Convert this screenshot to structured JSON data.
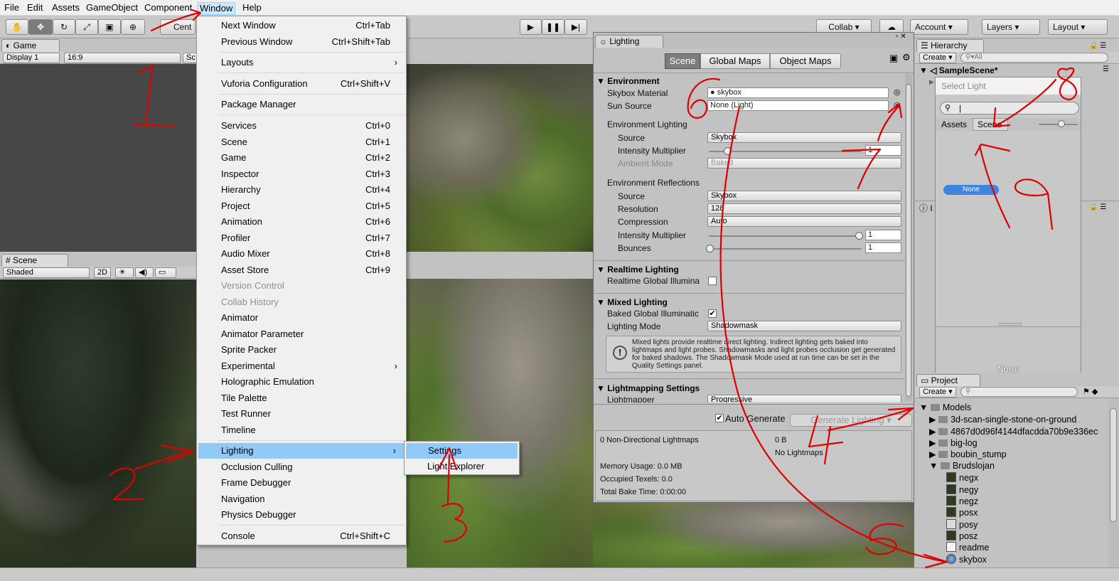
{
  "menubar": {
    "items": [
      "File",
      "Edit",
      "Assets",
      "GameObject",
      "Component",
      "Window",
      "Help"
    ],
    "active": "Window"
  },
  "toolbar": {
    "pivot_label": "Cent",
    "collab": "Collab ▾",
    "account": "Account",
    "layers": "Layers",
    "layout": "Layout"
  },
  "game_panel": {
    "tab": "Game",
    "display": "Display 1",
    "aspect": "16:9",
    "scale": "Sc"
  },
  "scene_panel": {
    "tab": "Scene",
    "shading": "Shaded",
    "mode_2d": "2D"
  },
  "window_menu": {
    "items": [
      {
        "label": "Next Window",
        "shortcut": "Ctrl+Tab"
      },
      {
        "label": "Previous Window",
        "shortcut": "Ctrl+Shift+Tab"
      },
      {
        "label": "Layouts",
        "shortcut": "›"
      },
      {
        "label": "Vuforia Configuration",
        "shortcut": "Ctrl+Shift+V"
      },
      {
        "label": "Package Manager",
        "shortcut": ""
      },
      {
        "label": "Services",
        "shortcut": "Ctrl+0"
      },
      {
        "label": "Scene",
        "shortcut": "Ctrl+1"
      },
      {
        "label": "Game",
        "shortcut": "Ctrl+2"
      },
      {
        "label": "Inspector",
        "shortcut": "Ctrl+3"
      },
      {
        "label": "Hierarchy",
        "shortcut": "Ctrl+4"
      },
      {
        "label": "Project",
        "shortcut": "Ctrl+5"
      },
      {
        "label": "Animation",
        "shortcut": "Ctrl+6"
      },
      {
        "label": "Profiler",
        "shortcut": "Ctrl+7"
      },
      {
        "label": "Audio Mixer",
        "shortcut": "Ctrl+8"
      },
      {
        "label": "Asset Store",
        "shortcut": "Ctrl+9"
      },
      {
        "label": "Version Control",
        "shortcut": ""
      },
      {
        "label": "Collab History",
        "shortcut": ""
      },
      {
        "label": "Animator",
        "shortcut": ""
      },
      {
        "label": "Animator Parameter",
        "shortcut": ""
      },
      {
        "label": "Sprite Packer",
        "shortcut": ""
      },
      {
        "label": "Experimental",
        "shortcut": "›"
      },
      {
        "label": "Holographic Emulation",
        "shortcut": ""
      },
      {
        "label": "Tile Palette",
        "shortcut": ""
      },
      {
        "label": "Test Runner",
        "shortcut": ""
      },
      {
        "label": "Timeline",
        "shortcut": ""
      },
      {
        "label": "Lighting",
        "shortcut": "›"
      },
      {
        "label": "Occlusion Culling",
        "shortcut": ""
      },
      {
        "label": "Frame Debugger",
        "shortcut": ""
      },
      {
        "label": "Navigation",
        "shortcut": ""
      },
      {
        "label": "Physics Debugger",
        "shortcut": ""
      },
      {
        "label": "Console",
        "shortcut": "Ctrl+Shift+C"
      }
    ],
    "submenu": [
      "Settings",
      "Light Explorer"
    ]
  },
  "lighting": {
    "title": "Lighting",
    "tabs": [
      "Scene",
      "Global Maps",
      "Object Maps"
    ],
    "environment": {
      "header": "Environment",
      "skybox_label": "Skybox Material",
      "skybox_value": "skybox",
      "sun_label": "Sun Source",
      "sun_value": "None (Light)",
      "env_lighting": "Environment Lighting",
      "source_label": "Source",
      "source_value": "Skybox",
      "intensity_label": "Intensity Multiplier",
      "intensity_value": "1",
      "ambient_label": "Ambient Mode",
      "ambient_value": "Baked",
      "env_reflections": "Environment Reflections",
      "refl_source_value": "Skybox",
      "resolution_label": "Resolution",
      "resolution_value": "128",
      "compression_label": "Compression",
      "compression_value": "Auto",
      "refl_intensity_value": "1",
      "bounces_label": "Bounces",
      "bounces_value": "1"
    },
    "realtime": {
      "header": "Realtime Lighting",
      "gi_label": "Realtime Global Illumina"
    },
    "mixed": {
      "header": "Mixed Lighting",
      "baked_label": "Baked Global Illuminatic",
      "mode_label": "Lighting Mode",
      "mode_value": "Shadowmask",
      "info": "Mixed lights provide realtime direct lighting. Indirect lighting gets baked into lightmaps and light probes. Shadowmasks and light probes occlusion get generated for baked shadows. The Shadowmask Mode used at run time can be set in the Quality Settings panel."
    },
    "lightmapping": {
      "header": "Lightmapping Settings",
      "lightmapper_label": "Lightmapper",
      "lightmapper_value": "Progressive"
    },
    "auto_generate": "Auto Generate",
    "generate_button": "Generate Lighting",
    "stats": {
      "lightmaps": "0 Non-Directional Lightmaps",
      "size": "0 B",
      "no_lightmaps": "No Lightmaps",
      "memory": "Memory Usage: 0.0 MB",
      "texels": "Occupied Texels: 0.0",
      "bake_time": "Total Bake Time: 0:00:00"
    }
  },
  "hierarchy": {
    "tab": "Hierarchy",
    "create": "Create ▾",
    "search": "All",
    "scene": "SampleScene*"
  },
  "select_light": {
    "title": "Select Light",
    "tab_assets": "Assets",
    "tab_scene": "Scene",
    "none_item": "None",
    "footer": "None"
  },
  "inspector": {
    "tab_stub": "I"
  },
  "project": {
    "tab": "Project",
    "create": "Create ▾",
    "tree": [
      "Models",
      "3d-scan-single-stone-on-ground",
      "4867d0d96f4144dfacdda70b9e336ec",
      "big-log",
      "boubin_stump",
      "Brudslojan",
      "negx",
      "negy",
      "negz",
      "posx",
      "posy",
      "posz",
      "readme",
      "skybox"
    ]
  },
  "annotations": [
    "1",
    "2",
    "3",
    "4",
    "5",
    "6",
    "7",
    "8",
    "9"
  ]
}
